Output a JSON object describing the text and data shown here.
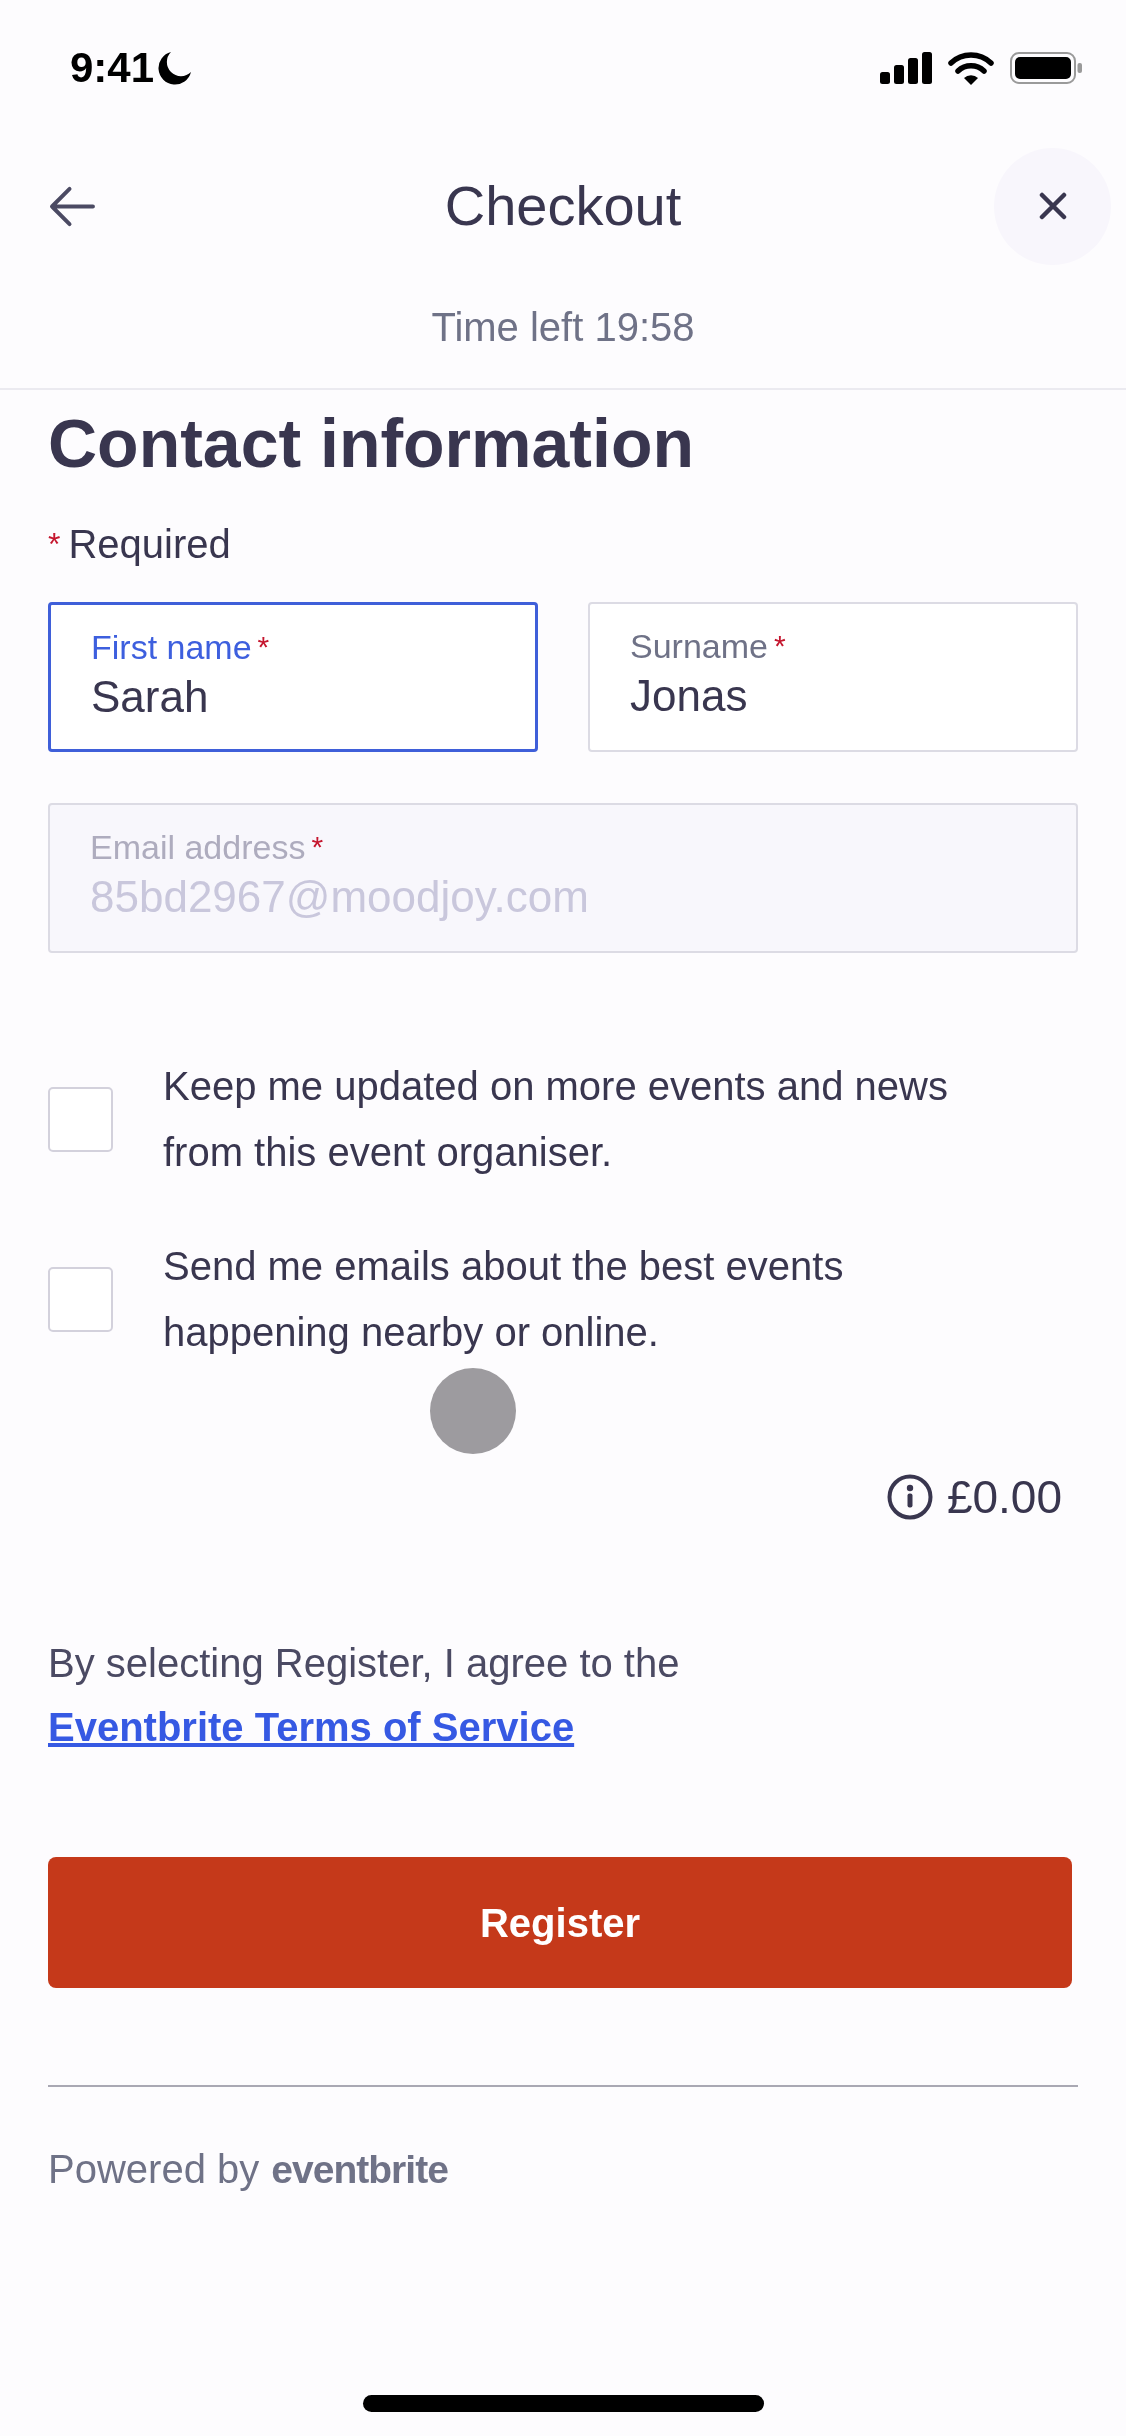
{
  "status_bar": {
    "time": "9:41"
  },
  "header": {
    "title": "Checkout",
    "timer": "Time left 19:58"
  },
  "contact": {
    "heading": "Contact information",
    "required_note": {
      "mark": "*",
      "text": "Required"
    },
    "field_rows": [
      [
        {
          "label": "First name",
          "mark": "*",
          "value": "Sarah",
          "focused": true,
          "disabled": false
        },
        {
          "label": "Surname",
          "mark": "*",
          "value": "Jonas",
          "focused": false,
          "disabled": false
        }
      ],
      [
        {
          "label": "Email address",
          "mark": "*",
          "value": "85bd2967@moodjoy.com",
          "focused": false,
          "disabled": true
        }
      ]
    ]
  },
  "opt_ins": [
    {
      "label": "Keep me updated on more events and news from this event organiser.",
      "checked": false
    },
    {
      "label": "Send me emails about the best events happening nearby or online.",
      "checked": false
    }
  ],
  "total": {
    "amount": "£0.00"
  },
  "terms": {
    "text": "By selecting Register, I agree to the",
    "link": "Eventbrite Terms of Service"
  },
  "register_button": {
    "label": "Register"
  },
  "footer": {
    "text": "Powered by",
    "brand": "eventbrite"
  }
}
